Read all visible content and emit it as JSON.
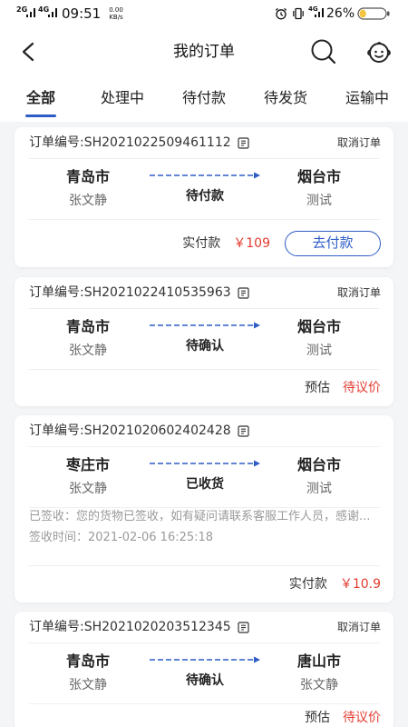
{
  "status_bar": {
    "network_1": "2G",
    "network_2": "4G",
    "time": "09:51",
    "speed_value": "0.00",
    "speed_unit": "KB/s",
    "network_3": "4G",
    "battery": "26%",
    "battery_level": 0.26
  },
  "header": {
    "title": "我的订单"
  },
  "tabs": [
    {
      "label": "全部",
      "active": true
    },
    {
      "label": "处理中",
      "active": false
    },
    {
      "label": "待付款",
      "active": false
    },
    {
      "label": "待发货",
      "active": false
    },
    {
      "label": "运输中",
      "active": false
    }
  ],
  "orders": [
    {
      "order_no": "订单编号:SH2021022509461112",
      "cancel_label": "取消订单",
      "from_city": "青岛市",
      "from_name": "张文静",
      "status": "待付款",
      "to_city": "烟台市",
      "to_name": "测试",
      "amount_label": "实付款",
      "amount": "￥109",
      "action_label": "去付款"
    },
    {
      "order_no": "订单编号:SH2021022410535963",
      "cancel_label": "取消订单",
      "from_city": "青岛市",
      "from_name": "张文静",
      "status": "待确认",
      "to_city": "烟台市",
      "to_name": "测试",
      "amount_label": "预估",
      "amount": "待议价"
    },
    {
      "order_no": "订单编号:SH2021020602402428",
      "from_city": "枣庄市",
      "from_name": "张文静",
      "status": "已收货",
      "to_city": "烟台市",
      "to_name": "测试",
      "sign_note": "已签收：您的货物已签收，如有疑问请联系客服工作人员，感谢...",
      "sign_time": "签收时间：2021-02-06 16:25:18",
      "amount_label": "实付款",
      "amount": "￥10.9"
    },
    {
      "order_no": "订单编号:SH2021020203512345",
      "cancel_label": "取消订单",
      "from_city": "青岛市",
      "from_name": "张文静",
      "status": "待确认",
      "to_city": "唐山市",
      "to_name": "张文静",
      "amount_label": "预估",
      "amount": "待议价"
    }
  ],
  "icons": {
    "back": "chevron-left-icon",
    "search": "search-icon",
    "service": "customer-service-icon",
    "copy": "copy-icon",
    "route": "dashed-arrow-icon",
    "alarm": "alarm-clock-icon",
    "vibrate": "vibrate-icon",
    "signal": "signal-icon",
    "battery": "battery-icon"
  },
  "colors": {
    "accent": "#2d5cc6",
    "price": "#e33b2f",
    "text_primary": "#222222",
    "text_secondary": "#666666",
    "text_muted": "#9a9a9a",
    "background": "#f4f5f7",
    "card": "#ffffff",
    "battery_fill": "#f5c542"
  }
}
